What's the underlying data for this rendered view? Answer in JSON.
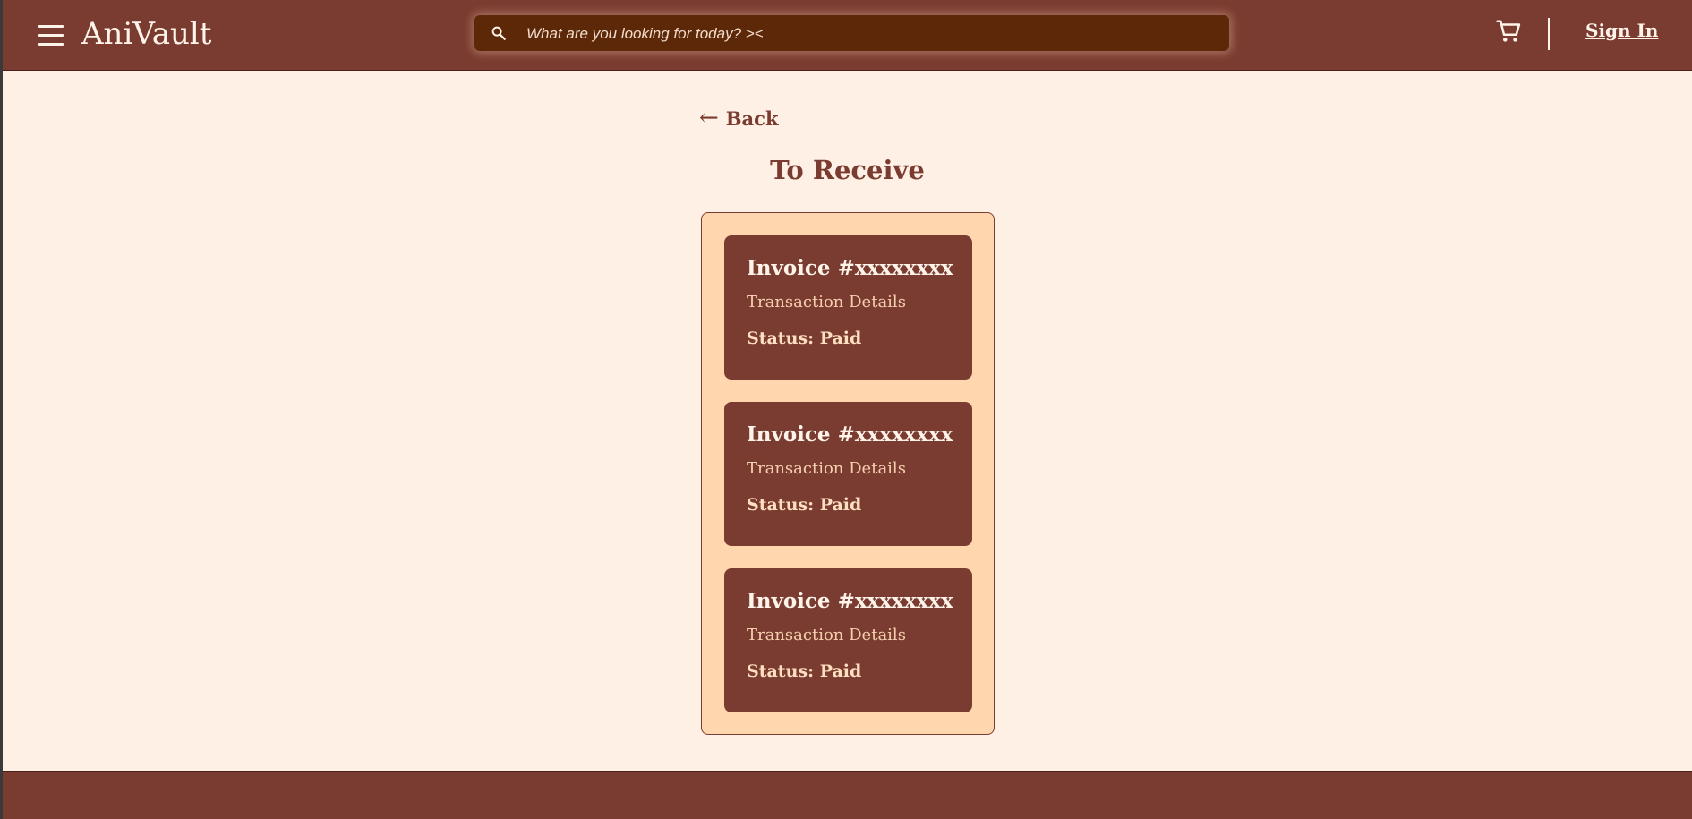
{
  "header": {
    "brand": "AniVault",
    "search_placeholder": "What are you looking for today? ><",
    "sign_in": "Sign In",
    "icons": {
      "menu": "hamburger-menu-icon",
      "search": "search-icon",
      "cart": "shopping-cart-icon"
    }
  },
  "main": {
    "back_arrow": "←",
    "back_label": "Back",
    "title": "To Receive",
    "invoices": [
      {
        "title": "Invoice #xxxxxxxx",
        "details": "Transaction Details",
        "status": "Status: Paid"
      },
      {
        "title": "Invoice #xxxxxxxx",
        "details": "Transaction Details",
        "status": "Status: Paid"
      },
      {
        "title": "Invoice #xxxxxxxx",
        "details": "Transaction Details",
        "status": "Status: Paid"
      }
    ]
  },
  "colors": {
    "primary": "#7a3c30",
    "background": "#fff0e5",
    "panel": "#ffd6ad",
    "search_bg": "#5c2808",
    "text_light": "#fff3ea"
  }
}
